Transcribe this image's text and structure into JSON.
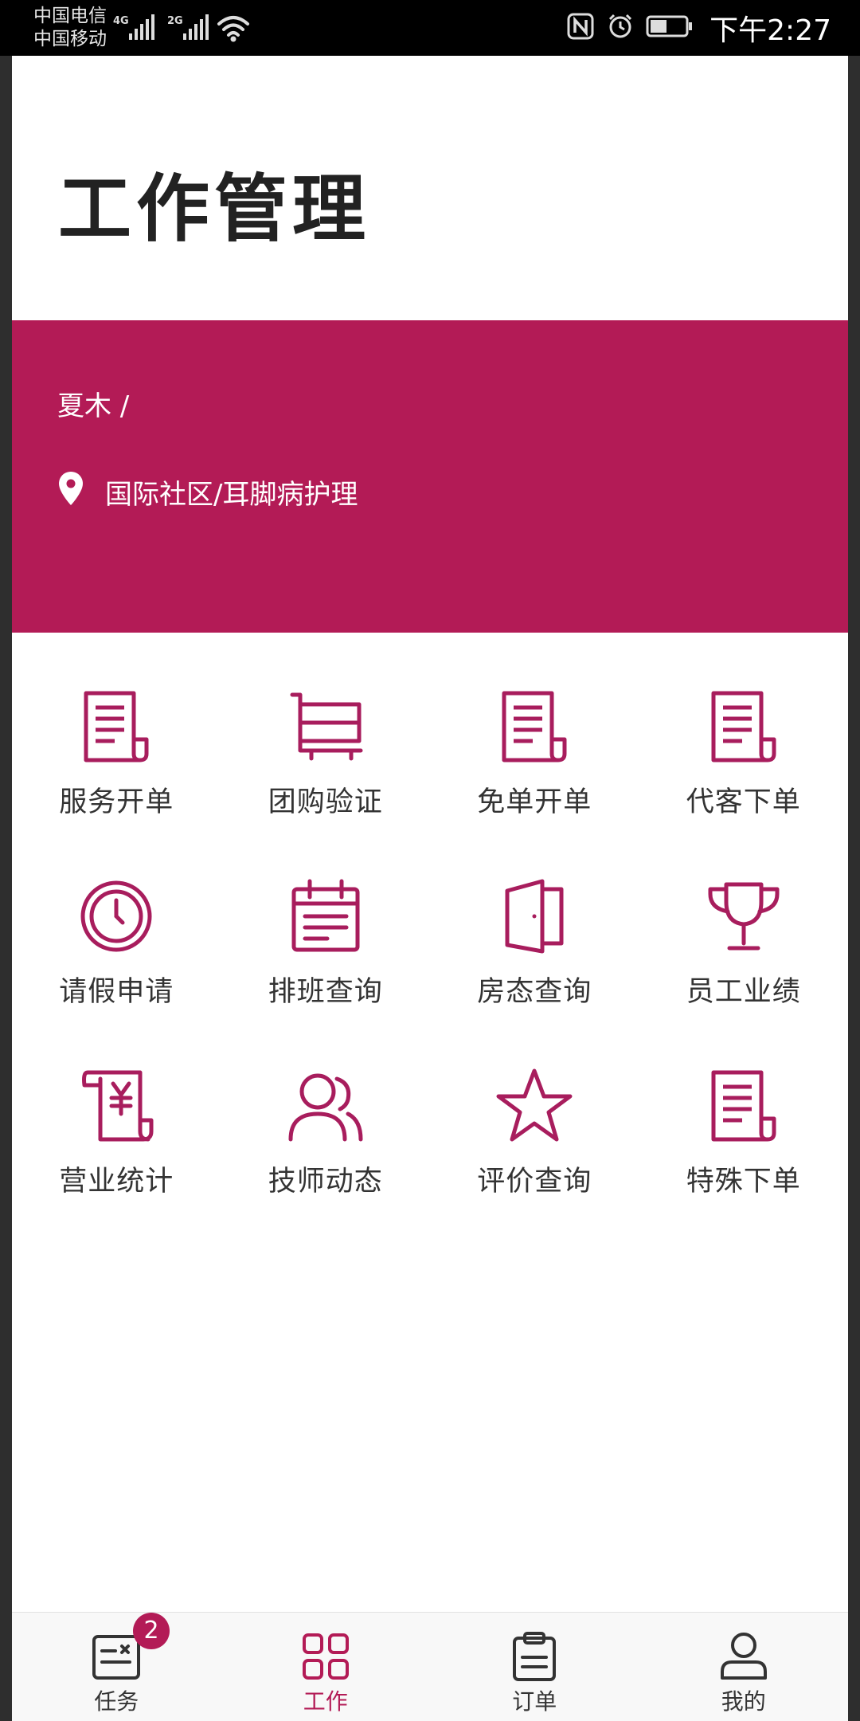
{
  "status_bar": {
    "carrier_1": "中国电信",
    "carrier_2": "中国移动",
    "network_1": "4G",
    "network_2": "2G",
    "time": "下午2:27"
  },
  "header": {
    "title": "工作管理"
  },
  "user": {
    "name": "夏木 /",
    "location": "国际社区/耳脚病护理"
  },
  "grid": {
    "items": [
      {
        "label": "服务开单",
        "icon": "document-icon"
      },
      {
        "label": "团购验证",
        "icon": "cart-icon"
      },
      {
        "label": "免单开单",
        "icon": "document-icon"
      },
      {
        "label": "代客下单",
        "icon": "document-icon"
      },
      {
        "label": "请假申请",
        "icon": "clock-icon"
      },
      {
        "label": "排班查询",
        "icon": "calendar-icon"
      },
      {
        "label": "房态查询",
        "icon": "door-icon"
      },
      {
        "label": "员工业绩",
        "icon": "trophy-icon"
      },
      {
        "label": "营业统计",
        "icon": "yen-scroll-icon"
      },
      {
        "label": "技师动态",
        "icon": "users-icon"
      },
      {
        "label": "评价查询",
        "icon": "star-icon"
      },
      {
        "label": "特殊下单",
        "icon": "document-icon"
      }
    ]
  },
  "bottom_nav": {
    "items": [
      {
        "label": "任务",
        "icon": "task-icon",
        "badge": "2"
      },
      {
        "label": "工作",
        "icon": "grid-icon",
        "active": true
      },
      {
        "label": "订单",
        "icon": "clipboard-icon"
      },
      {
        "label": "我的",
        "icon": "person-icon"
      }
    ]
  },
  "colors": {
    "brand": "#b31b56",
    "text": "#333333",
    "status_bar": "#000000"
  }
}
